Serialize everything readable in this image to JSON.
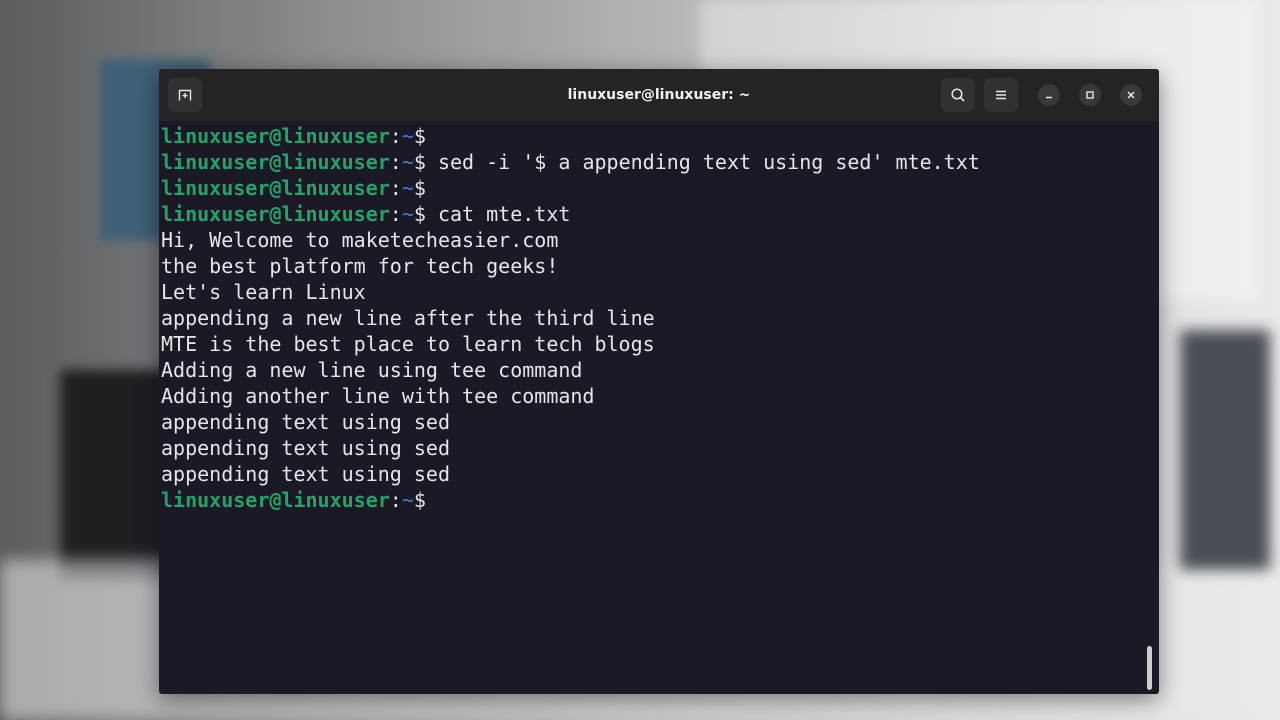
{
  "window": {
    "title": "linuxuser@linuxuser: ~"
  },
  "icons": {
    "new_tab": "new-tab-icon",
    "search": "search-icon",
    "menu": "hamburger-menu-icon",
    "minimize": "minimize-icon",
    "maximize": "maximize-icon",
    "close": "close-icon"
  },
  "colors": {
    "prompt_user": "#26a269",
    "prompt_path": "#3f7fd6",
    "terminal_bg": "#1c1927"
  },
  "terminal": {
    "lines": [
      {
        "user": "linuxuser@linuxuser",
        "path": "~",
        "sigil": "$",
        "cmd": ""
      },
      {
        "user": "linuxuser@linuxuser",
        "path": "~",
        "sigil": "$",
        "cmd": " sed -i '$ a appending text using sed' mte.txt"
      },
      {
        "user": "linuxuser@linuxuser",
        "path": "~",
        "sigil": "$",
        "cmd": ""
      },
      {
        "user": "linuxuser@linuxuser",
        "path": "~",
        "sigil": "$",
        "cmd": " cat mte.txt"
      },
      {
        "text": "Hi, Welcome to maketecheasier.com"
      },
      {
        "text": "the best platform for tech geeks!"
      },
      {
        "text": "Let's learn Linux"
      },
      {
        "text": "appending a new line after the third line"
      },
      {
        "text": "MTE is the best place to learn tech blogs"
      },
      {
        "text": "Adding a new line using tee command"
      },
      {
        "text": "Adding another line with tee command"
      },
      {
        "text": "appending text using sed"
      },
      {
        "text": "appending text using sed"
      },
      {
        "text": "appending text using sed"
      },
      {
        "user": "linuxuser@linuxuser",
        "path": "~",
        "sigil": "$",
        "cmd": ""
      }
    ]
  }
}
